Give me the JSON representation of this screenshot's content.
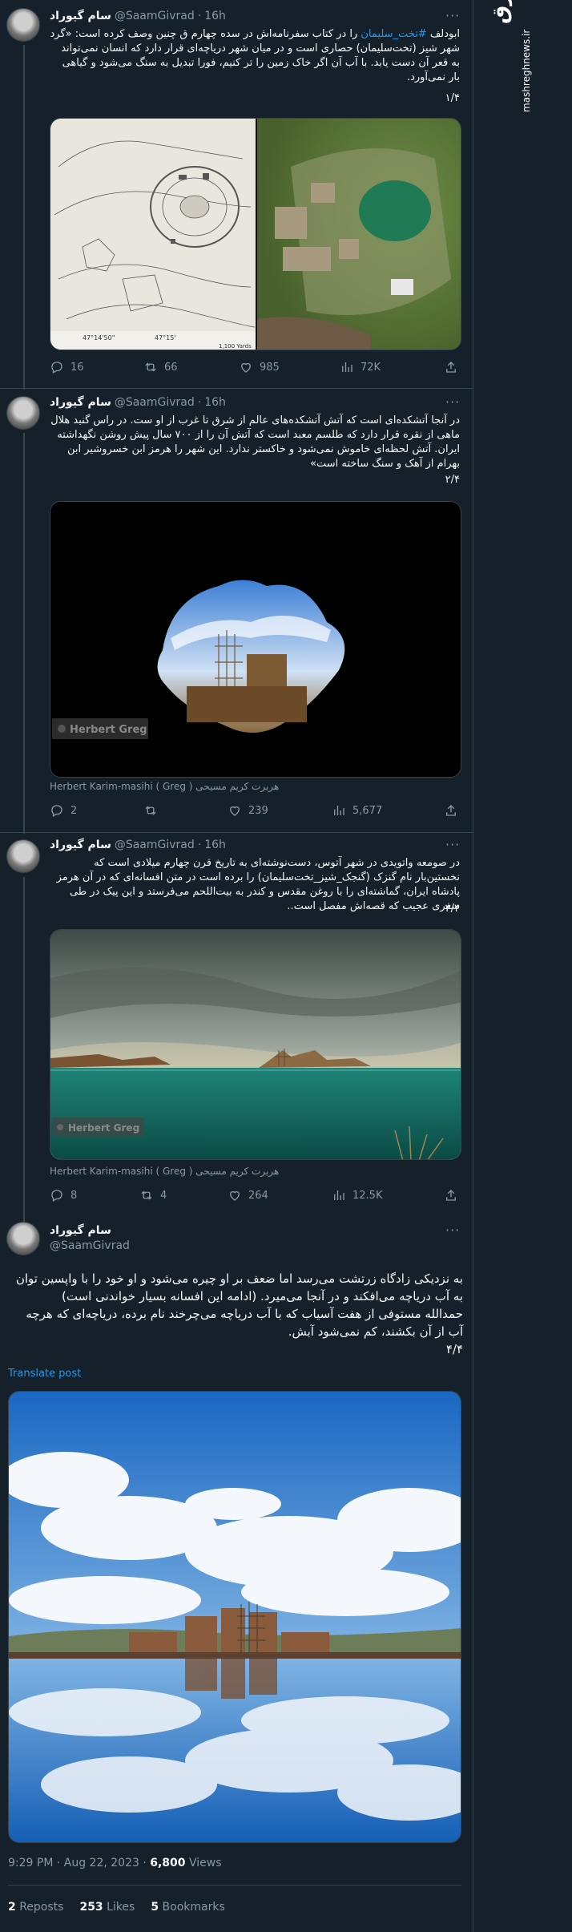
{
  "watermark": {
    "logo": "مشرق",
    "url": "mashreghnews.ir"
  },
  "tweets": [
    {
      "name": "سام گیوراد",
      "handle": "@SaamGivrad",
      "time": "16h",
      "text_before": "ابودلف ",
      "hashtag": "#تخت_سلیمان",
      "text_after": " را در کتاب سفرنامه‌اش در سده چهارم ق چنین وصف کرده است: «گرد شهر شیز (تخت‌سلیمان) حصاری است و در میان شهر دریاچه‌ای قرار دارد که انسان نمی‌تواند به قعر آن دست یابد. با آب آن اگر خاک زمین را تر کنیم، فورا تبدیل به سنگ می‌شود و گیاهی بار نمی‌آورد.",
      "number": "۱/۴",
      "map_labels": [
        "47°14'50\"",
        "47°15'",
        "1,100 Yards"
      ],
      "stats": {
        "replies": "16",
        "reposts": "66",
        "likes": "985",
        "views": "72K"
      }
    },
    {
      "name": "سام گیوراد",
      "handle": "@SaamGivrad",
      "time": "16h",
      "text": "در آنجا آتشکده‌ای است که آتش آتشکده‌های عالم از شرق تا غرب از او ست. در راس گنبد هلال ماهی از نقره قرار دارد که طلسم معبد است که آتش آن را از ۷۰۰ سال پیش روشن نگهداشته ایران. آتش لحظه‌ای خاموش نمی‌شود و خاکستر ندارد. این شهر را هرمز ابن خسروشیر ابن بهرام از آهک و سنگ ساخته است»",
      "number": "۲/۴",
      "watermark": "Herbert Greg",
      "caption": "Herbert Karim-masihi ( Greg ) هربرت کریم مسیحی",
      "stats": {
        "replies": "2",
        "reposts": "",
        "likes": "239",
        "views": "5,677"
      }
    },
    {
      "name": "سام گیوراد",
      "handle": "@SaamGivrad",
      "time": "16h",
      "text": "در صومعه واتویدی در شهر آتوس، دست‌نوشته‌ای به تاریخ قرن چهارم میلادی است که نخستین‌بار نام گنزک (گنجک_شیز_تخت‌سلیمان) را برده است در متن افسانه‌ای که در آن هرمز پادشاه ایران، گماشته‌ای را با روغن مقدس و کندر به بیت‌اللحم می‌فرستد و این پیک در طی سفری عجیب که قصه‌اش مفصل است..",
      "number": "۳/۴",
      "watermark": "Herbert Greg",
      "caption": "Herbert Karim-masihi ( Greg ) هربرت کریم مسیحی",
      "stats": {
        "replies": "8",
        "reposts": "4",
        "likes": "264",
        "views": "12.5K"
      }
    }
  ],
  "main": {
    "name": "سام گیوراد",
    "handle": "@SaamGivrad",
    "line1": "به نزدیکی زادگاه زرتشت می‌رسد اما ضعف بر او چیره می‌شود و او خود را با واپسین توان به آب دریاچه می‌افکند و در آنجا می‌میرد. (ادامه این افسانه بسیار خواندنی است)",
    "line2": "حمدالله مستوفی از هفت آسیاب که با آب دریاچه می‌چرخند نام برده، دریاچه‌ای که هرچه آب از آن بکشند، کم نمی‌شود آبش.",
    "number": "۴/۴",
    "translate": "Translate post",
    "time": "9:29 PM · Aug 22, 2023 · ",
    "views": "6,800",
    "views_label": " Views",
    "reposts": "2",
    "reposts_label": " Reposts",
    "likes": "253",
    "likes_label": " Likes",
    "bookmarks": "5",
    "bookmarks_label": " Bookmarks"
  },
  "colors": {
    "background": "#15202b",
    "accent": "#1d9bf0",
    "muted": "#8b98a5",
    "border": "#38444d"
  }
}
